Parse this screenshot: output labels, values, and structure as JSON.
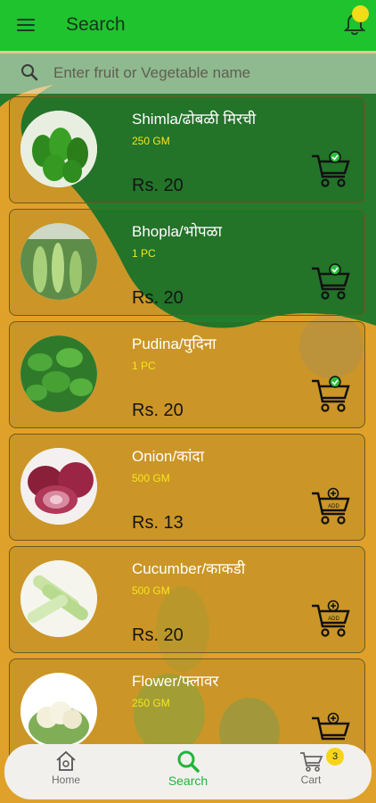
{
  "topbar": {
    "title": "Search"
  },
  "search": {
    "placeholder": "Enter fruit or Vegetable name"
  },
  "products": [
    {
      "name": "Shimla/ढोबळी मिरची",
      "qty": "250 GM",
      "price": "Rs. 20",
      "cart_state": "added",
      "image": "green-capsicum"
    },
    {
      "name": "Bhopla/भोपळा",
      "qty": "1 PC",
      "price": "Rs. 20",
      "cart_state": "added",
      "image": "bottle-gourd"
    },
    {
      "name": "Pudina/पुदिना",
      "qty": "1 PC",
      "price": "Rs. 20",
      "cart_state": "added",
      "image": "mint-leaves"
    },
    {
      "name": "Onion/कांदा",
      "qty": "500 GM",
      "price": "Rs. 13",
      "cart_state": "add",
      "image": "red-onion"
    },
    {
      "name": "Cucumber/काकडी",
      "qty": "500 GM",
      "price": "Rs. 20",
      "cart_state": "add",
      "image": "cucumber"
    },
    {
      "name": "Flower/फ्लावर",
      "qty": "250 GM",
      "price": "",
      "cart_state": "add",
      "image": "cauliflower"
    }
  ],
  "cart_add_label": "ADD",
  "nav": {
    "home": "Home",
    "search": "Search",
    "cart": "Cart",
    "cart_count": "3"
  },
  "colors": {
    "topbar": "#1fc32e",
    "background": "#e0a12a",
    "accent_green": "#23b43a",
    "qty_yellow": "#f6e51c",
    "badge": "#f6d41a"
  }
}
